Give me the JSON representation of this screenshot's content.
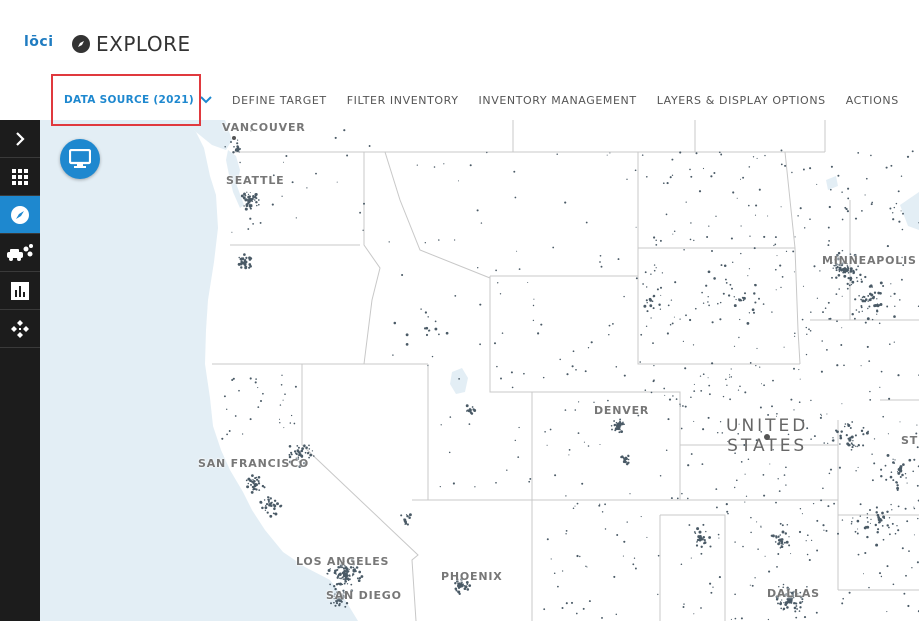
{
  "app": {
    "logo_text": "lōci",
    "page_title": "EXPLORE"
  },
  "nav": {
    "items": [
      {
        "label": "DATA SOURCE (2021)",
        "active": true
      },
      {
        "label": "DEFINE TARGET"
      },
      {
        "label": "FILTER INVENTORY"
      },
      {
        "label": "INVENTORY MANAGEMENT"
      },
      {
        "label": "LAYERS & DISPLAY OPTIONS"
      },
      {
        "label": "ACTIONS"
      }
    ]
  },
  "sidebar": {
    "items": [
      {
        "icon": "chevron-right-icon"
      },
      {
        "icon": "grid-icon"
      },
      {
        "icon": "compass-icon",
        "active": true
      },
      {
        "icon": "vehicles-icon"
      },
      {
        "icon": "bar-chart-icon"
      },
      {
        "icon": "diamond-network-icon"
      }
    ]
  },
  "map": {
    "country_label_line1": "UNITED",
    "country_label_line2": "STATES",
    "cities": {
      "vancouver": "VANCOUVER",
      "seattle": "SEATTLE",
      "minneapolis": "MINNEAPOLIS",
      "denver": "DENVER",
      "san_francisco": "SAN FRANCISCO",
      "los_angeles": "LOS ANGELES",
      "san_diego": "SAN DIEGO",
      "phoenix": "PHOENIX",
      "dallas": "DALLAS",
      "st_partial": "ST"
    }
  },
  "colors": {
    "accent": "#1e88cf",
    "highlight": "#e0393e",
    "water": "#e3eef5",
    "sidebar": "#1c1c1c",
    "dots": "#4a5a66"
  }
}
